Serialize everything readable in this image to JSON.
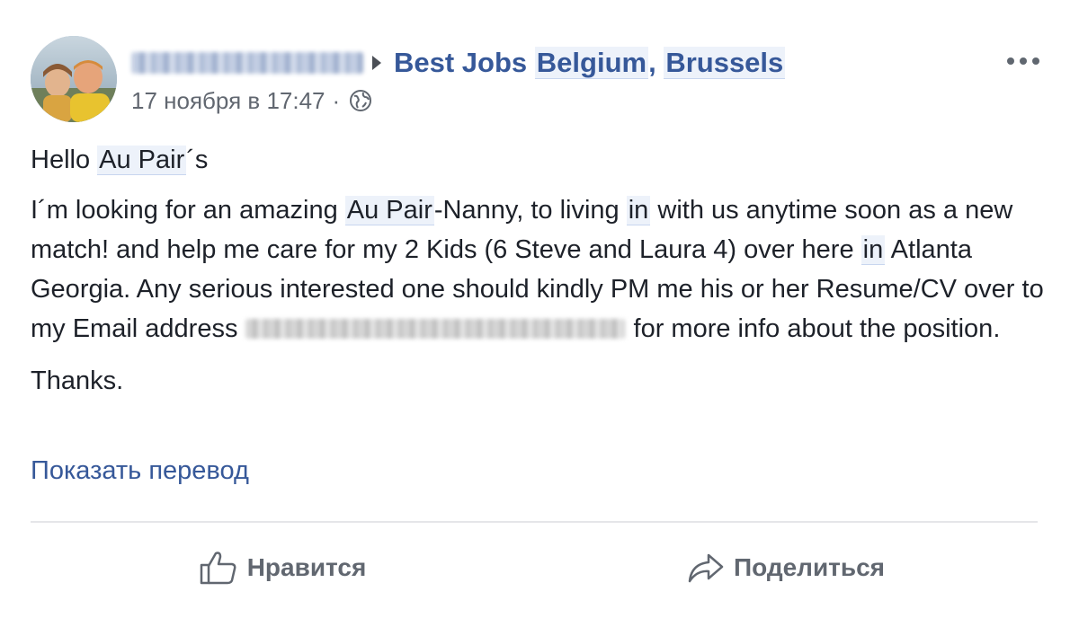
{
  "post": {
    "author": {
      "name_redacted": true,
      "avatar": "profile-photo"
    },
    "group_prefix": "Best Jobs ",
    "group_highlight_1": "Belgium",
    "group_separator": ", ",
    "group_highlight_2": "Brussels",
    "timestamp": "17 ноября в 17:47",
    "meta_separator": "·",
    "privacy_icon": "globe-icon",
    "more_icon": "more-options-icon",
    "greeting": {
      "prefix": "Hello ",
      "highlight": "Au Pair",
      "suffix": "´s"
    },
    "message": {
      "part1": "I´m looking for an amazing ",
      "highlight1": "Au Pair",
      "part2": "-Nanny, to living ",
      "highlight2": "in",
      "part3": " with us anytime soon as a new match! and help me care for my 2 Kids (6 Steve and Laura 4) over here ",
      "highlight3": "in",
      "part4": " Atlanta Georgia. Any serious interested one should kindly PM me his or her Resume/CV over to my Email address ",
      "email_redacted": true,
      "part5": "for more info about the position."
    },
    "closing": "Thanks.",
    "translate_link": "Показать перевод"
  },
  "actions": {
    "like_label": "Нравится",
    "like_icon": "thumbs-up-icon",
    "share_label": "Поделиться",
    "share_icon": "share-arrow-icon"
  },
  "colors": {
    "link": "#365899",
    "text": "#1d2129",
    "meta": "#616770",
    "divider": "#e5e6e9",
    "highlight_bg": "#edf2fa"
  }
}
